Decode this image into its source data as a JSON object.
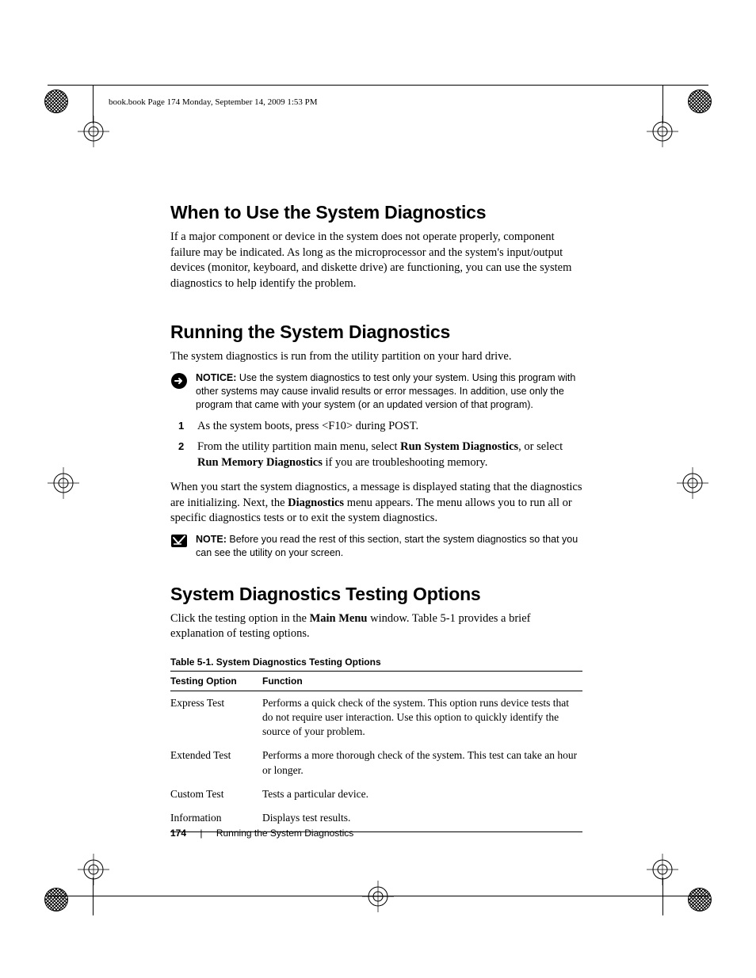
{
  "running_header": "book.book  Page 174  Monday, September 14, 2009  1:53 PM",
  "sections": {
    "when": {
      "title": "When to Use the System Diagnostics",
      "para": "If a major component or device in the system does not operate properly, component failure may be indicated. As long as the microprocessor and the system's input/output devices (monitor, keyboard, and diskette drive) are functioning, you can use the system diagnostics to help identify the problem."
    },
    "running": {
      "title": "Running the System Diagnostics",
      "para": "The system diagnostics is run from the utility partition on your hard drive.",
      "notice_lead": "NOTICE:",
      "notice_body": " Use the system diagnostics to test only your system. Using this program with other systems may cause invalid results or error messages. In addition, use only the program that came with your system (or an updated version of that program).",
      "step1": "As the system boots, press <F10> during POST.",
      "step2_a": "From the utility partition main menu, select ",
      "step2_b": "Run System Diagnostics",
      "step2_c": ", or select ",
      "step2_d": "Run Memory Diagnostics",
      "step2_e": " if you are troubleshooting memory.",
      "after_a": "When you start the system diagnostics, a message is displayed stating that the diagnostics are initializing. Next, the ",
      "after_b": "Diagnostics",
      "after_c": " menu appears. The menu allows you to run all or specific diagnostics tests or to exit the system diagnostics.",
      "note_lead": "NOTE:",
      "note_body": " Before you read the rest of this section, start the system diagnostics so that you can see the utility on your screen."
    },
    "options": {
      "title": "System Diagnostics Testing Options",
      "para_a": "Click the testing option in the ",
      "para_b": "Main Menu",
      "para_c": " window. Table 5-1 provides a brief explanation of testing options.",
      "table_caption": "Table 5-1.    System Diagnostics Testing Options",
      "col1": "Testing Option",
      "col2": "Function",
      "rows": [
        {
          "opt": "Express Test",
          "fn": "Performs a quick check of the system. This option runs device tests that do not require user interaction. Use this option to quickly identify the source of your problem."
        },
        {
          "opt": "Extended Test",
          "fn": "Performs a more thorough check of the system. This test can take an hour or longer."
        },
        {
          "opt": "Custom Test",
          "fn": "Tests a particular device."
        },
        {
          "opt": "Information",
          "fn": "Displays test results."
        }
      ]
    }
  },
  "footer": {
    "page": "174",
    "chapter": "Running the System Diagnostics"
  }
}
